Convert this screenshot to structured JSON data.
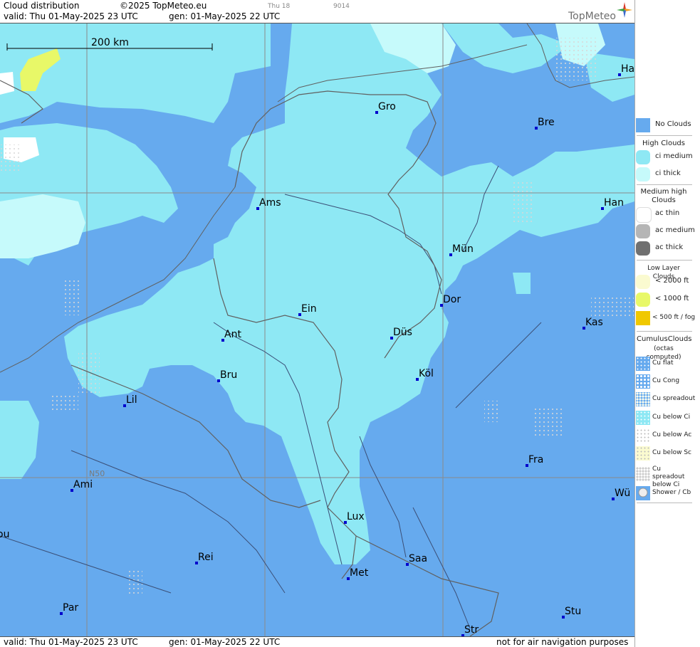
{
  "header": {
    "title": "Cloud distribution",
    "copyright": "©2025 TopMeteo.eu",
    "valid": "valid:  Thu  01-May-2025  23 UTC",
    "gen": "gen: 01-May-2025 22 UTC",
    "tiny_left": "Thu 18",
    "tiny_right": "9014",
    "brand": "TopMeteo"
  },
  "footer": {
    "valid": "valid:  Thu  01-May-2025  23 UTC",
    "gen": "gen: 01-May-2025 22 UTC",
    "disclaimer": "not for air navigation purposes"
  },
  "map": {
    "scale_label": "200 km",
    "lat_label": "N50",
    "colors": {
      "no_clouds": "#66aaee",
      "ci_medium": "#8ee8f4",
      "ci_thick": "#c6fafb",
      "low_1000": "#e8f868",
      "white": "#ffffff",
      "border": "#606060",
      "river": "#3b4f77",
      "grid": "#8a8a8a",
      "city_dot": "#0000cc"
    },
    "cities": [
      {
        "name": "Gro"
      },
      {
        "name": "Bre"
      },
      {
        "name": "Ha"
      },
      {
        "name": "Ams"
      },
      {
        "name": "Han"
      },
      {
        "name": "Mün"
      },
      {
        "name": "Ein"
      },
      {
        "name": "Dor"
      },
      {
        "name": "Ant"
      },
      {
        "name": "Düs"
      },
      {
        "name": "Kas"
      },
      {
        "name": "Bru"
      },
      {
        "name": "Köl"
      },
      {
        "name": "Lil"
      },
      {
        "name": "Fra"
      },
      {
        "name": "Ami"
      },
      {
        "name": "Wü"
      },
      {
        "name": "Lux"
      },
      {
        "name": "ou"
      },
      {
        "name": "Rei"
      },
      {
        "name": "Saa"
      },
      {
        "name": "Met"
      },
      {
        "name": "Par"
      },
      {
        "name": "Stu"
      },
      {
        "name": "Str"
      }
    ]
  },
  "legend": {
    "no_clouds": "No Clouds",
    "high_head": "High Clouds",
    "ci_medium": "ci medium",
    "ci_thick": "ci thick",
    "medium_head": "Medium high Clouds",
    "ac_thin": "ac thin",
    "ac_medium": "ac medium",
    "ac_thick": "ac thick",
    "low_head": "Low Layer Clouds",
    "low_2000": "< 2000 ft",
    "low_1000": "< 1000 ft",
    "low_500": "< 500 ft / fog",
    "cu_head": "CumulusClouds",
    "cu_sub": "(octas computed)",
    "cu_flat": "Cu flat",
    "cu_cong": "Cu Cong",
    "cu_spread": "Cu spreadout",
    "cu_below_ci": "Cu below Ci",
    "cu_below_ac": "Cu below Ac",
    "cu_below_sc": "Cu below Sc",
    "cu_spread_ci": "Cu spreadout below Ci",
    "shower": "Shower / Cb"
  }
}
